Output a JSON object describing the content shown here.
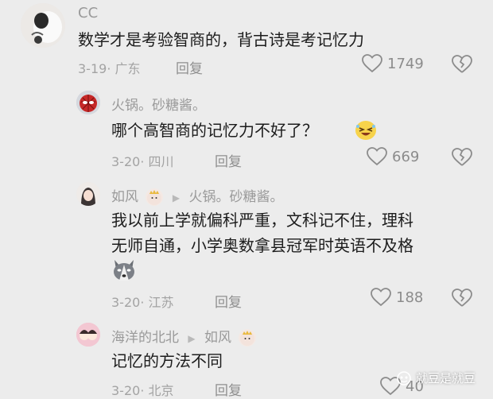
{
  "comments": [
    {
      "username": "CC",
      "text": "数学才是考验智商的，背古诗是考记忆力",
      "date": "3-19",
      "location": "· 广东",
      "reply_label": "回复",
      "likes": "1749"
    },
    {
      "username": "火锅。砂糖酱。",
      "text": "哪个高智商的记忆力不好了？",
      "date": "3-20",
      "location": "· 四川",
      "reply_label": "回复",
      "likes": "669"
    },
    {
      "username": "如风",
      "reply_to": "火锅。砂糖酱。",
      "text_line1": "我以前上学就偏科严重，文科记不住，理科",
      "text_line2": "无师自通，小学奥数拿县冠军时英语不及格",
      "date": "3-20",
      "location": "· 江苏",
      "reply_label": "回复",
      "likes": "188"
    },
    {
      "username": "海洋的北北",
      "reply_to": "如风",
      "text": "记忆的方法不同",
      "date": "3-20",
      "location": "· 北京",
      "reply_label": "回复",
      "likes": "40"
    }
  ],
  "watermark": "就豆是就豆",
  "colors": {
    "background": "#ececec",
    "muted_text": "#a3a3a3",
    "username": "#9a9a9a"
  }
}
